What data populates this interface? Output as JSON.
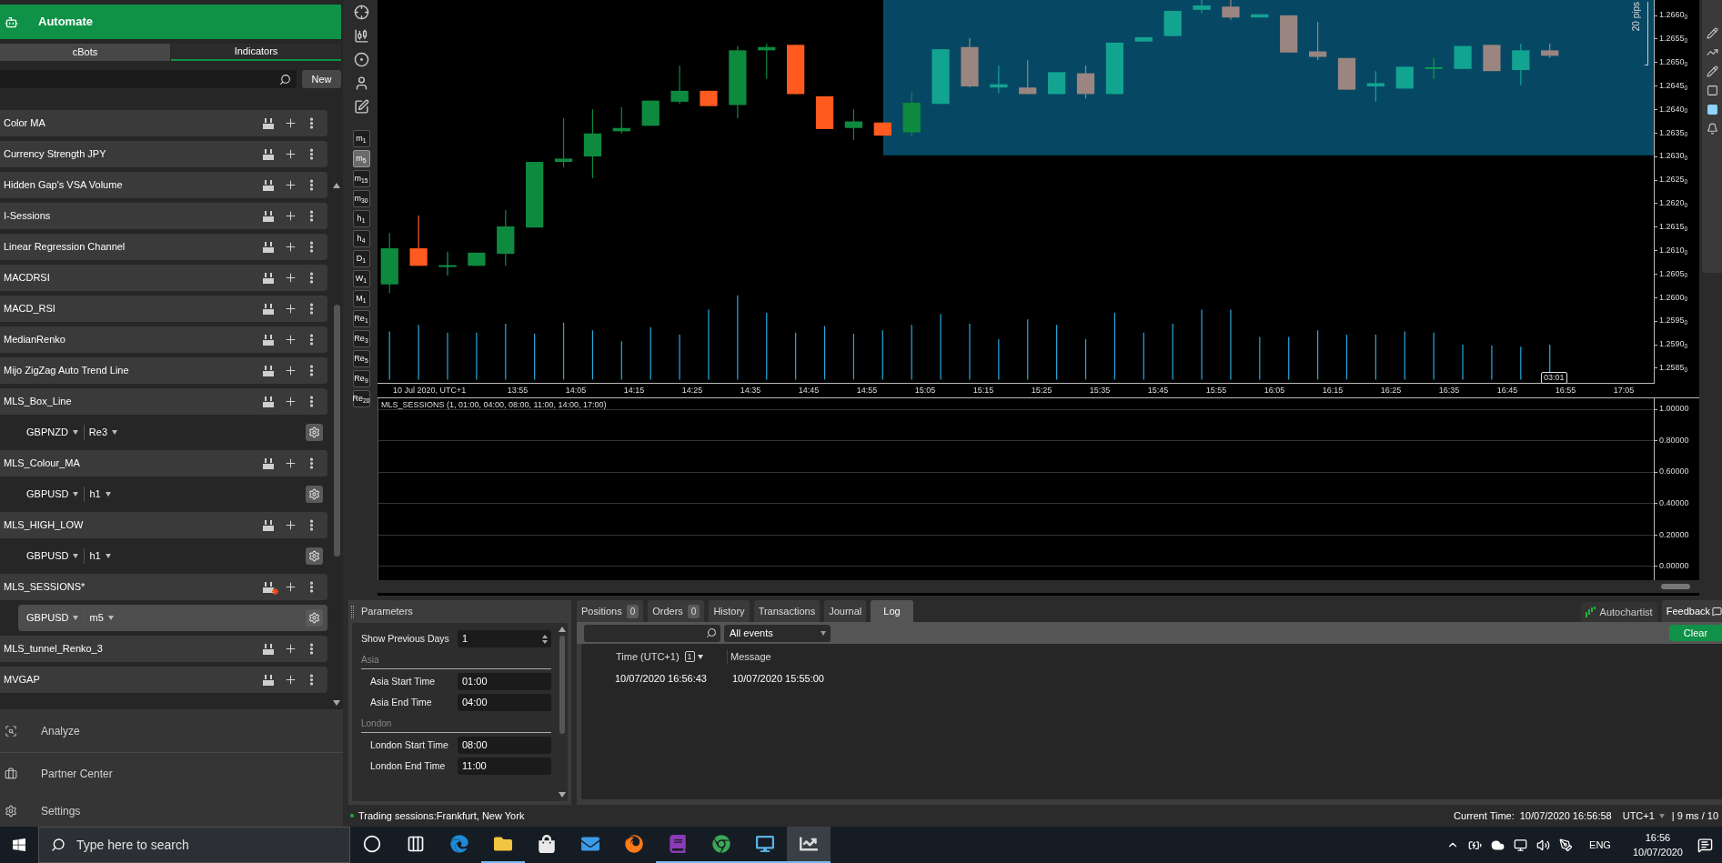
{
  "sidebar": {
    "title": "Automate",
    "tabs": [
      {
        "label": "cBots",
        "selected": false
      },
      {
        "label": "Indicators",
        "selected": true
      }
    ],
    "new_button": "New",
    "items": [
      {
        "kind": "indicator",
        "name": "Color MA",
        "modified": false
      },
      {
        "kind": "indicator",
        "name": "Currency Strength JPY",
        "modified": false
      },
      {
        "kind": "indicator",
        "name": "Hidden Gap's VSA Volume",
        "modified": false
      },
      {
        "kind": "indicator",
        "name": "I-Sessions",
        "modified": false
      },
      {
        "kind": "indicator",
        "name": "Linear Regression Channel",
        "modified": false
      },
      {
        "kind": "indicator",
        "name": "MACDRSI",
        "modified": false
      },
      {
        "kind": "indicator",
        "name": "MACD_RSI",
        "modified": false
      },
      {
        "kind": "indicator",
        "name": "MedianRenko",
        "modified": false
      },
      {
        "kind": "indicator",
        "name": "Mijo ZigZag Auto Trend Line",
        "modified": false
      },
      {
        "kind": "indicator",
        "name": "MLS_Box_Line",
        "modified": false
      },
      {
        "kind": "instance",
        "symbol": "GBPNZD",
        "timeframe": "Re3",
        "selected": false
      },
      {
        "kind": "indicator",
        "name": "MLS_Colour_MA",
        "modified": false
      },
      {
        "kind": "instance",
        "symbol": "GBPUSD",
        "timeframe": "h1",
        "selected": false
      },
      {
        "kind": "indicator",
        "name": "MLS_HIGH_LOW",
        "modified": false
      },
      {
        "kind": "instance",
        "symbol": "GBPUSD",
        "timeframe": "h1",
        "selected": false
      },
      {
        "kind": "indicator",
        "name": "MLS_SESSIONS*",
        "modified": true
      },
      {
        "kind": "instance",
        "symbol": "GBPUSD",
        "timeframe": "m5",
        "selected": true
      },
      {
        "kind": "indicator",
        "name": "MLS_tunnel_Renko_3",
        "modified": false
      },
      {
        "kind": "indicator",
        "name": "MVGAP",
        "modified": false
      }
    ],
    "nav": [
      {
        "kind": "analyze",
        "label": "Analyze"
      },
      {
        "kind": "partner",
        "label": "Partner Center"
      },
      {
        "kind": "settings",
        "label": "Settings"
      }
    ]
  },
  "chart": {
    "timeframes": [
      {
        "label": "m$_{1}$",
        "selected": false
      },
      {
        "label": "m$_{5}$",
        "selected": true
      },
      {
        "label": "m$_{15}$",
        "selected": false
      },
      {
        "label": "m$_{30}$",
        "selected": false
      },
      {
        "label": "h$_{1}$",
        "selected": false
      },
      {
        "label": "h$_{4}$",
        "selected": false
      },
      {
        "label": "D$_{1}$",
        "selected": false
      },
      {
        "label": "W$_{1}$",
        "selected": false
      },
      {
        "label": "M$_{1}$",
        "selected": false
      },
      {
        "label": "Re$_{1}$",
        "selected": false
      },
      {
        "label": "Re$_{3}$",
        "selected": false
      },
      {
        "label": "Re$_{5}$",
        "selected": false
      },
      {
        "label": "Re$_{9}$",
        "selected": false
      },
      {
        "label": "Re$_{20}$",
        "selected": false
      }
    ],
    "price_ticks": [
      "1.2660$_{0}$",
      "1.2655$_{0}$",
      "1.2650$_{0}$",
      "1.2645$_{0}$",
      "1.2640$_{0}$",
      "1.2635$_{0}$",
      "1.2630$_{0}$",
      "1.2625$_{0}$",
      "1.2620$_{0}$",
      "1.2615$_{0}$",
      "1.2610$_{0}$",
      "1.2605$_{0}$",
      "1.2600$_{0}$",
      "1.2595$_{0}$",
      "1.2590$_{0}$",
      "1.2585$_{0}$"
    ],
    "date_label": "10 Jul 2020, UTC+1",
    "time_labels": [
      "13:55",
      "14:05",
      "14:15",
      "14:25",
      "14:35",
      "14:45",
      "14:55",
      "15:05",
      "15:15",
      "15:25",
      "15:35",
      "15:45",
      "15:55",
      "16:05",
      "16:15",
      "16:25",
      "16:35",
      "16:45",
      "16:55",
      "17:05"
    ],
    "countdown": "03:01",
    "range_label": "20 pips",
    "indicator": {
      "title": "MLS_SESSIONS (1, 01:00, 04:00, 08:00, 11:00, 14:00, 17:00)",
      "ticks": [
        "1.00000",
        "0.80000",
        "0.60000",
        "0.40000",
        "0.20000",
        "0.00000"
      ]
    }
  },
  "parameters": {
    "title": "Parameters",
    "rows": [
      {
        "kind": "spinner",
        "label": "Show Previous Days",
        "value": "1"
      },
      {
        "kind": "section",
        "label": "Asia"
      },
      {
        "kind": "field",
        "label": "Asia Start Time",
        "value": "01:00"
      },
      {
        "kind": "field",
        "label": "Asia End Time",
        "value": "04:00"
      },
      {
        "kind": "section",
        "label": "London"
      },
      {
        "kind": "field",
        "label": "London Start Time",
        "value": "08:00"
      },
      {
        "kind": "field",
        "label": "London End Time",
        "value": "11:00"
      }
    ]
  },
  "log": {
    "tabs": [
      {
        "label": "Positions",
        "count": "0",
        "selected": false
      },
      {
        "label": "Orders",
        "count": "0",
        "selected": false
      },
      {
        "label": "History",
        "selected": false
      },
      {
        "label": "Transactions",
        "selected": false
      },
      {
        "label": "Journal",
        "selected": false
      },
      {
        "label": "Log",
        "selected": true
      }
    ],
    "autochartist": "Autochartist",
    "feedback": "Feedback",
    "filter": "All events",
    "clear": "Clear",
    "columns": [
      {
        "label": "Time (UTC+1)",
        "sort_badge": "1"
      },
      {
        "label": "Message"
      }
    ],
    "rows": [
      [
        "10/07/2020 16:56:43",
        "10/07/2020 15:55:00"
      ]
    ]
  },
  "status_bar": {
    "sessions": "Trading sessions:Frankfurt, New York",
    "current_time_label": "Current Time:",
    "current_time": "10/07/2020 16:56:58",
    "timezone": "UTC+1",
    "latency": "| 9 ms / 10"
  },
  "taskbar": {
    "search_placeholder": "Type here to search",
    "apps": [
      {
        "kind": "cortana",
        "running": false,
        "selected": false
      },
      {
        "kind": "taskview",
        "running": false,
        "selected": false
      },
      {
        "kind": "edge",
        "running": false,
        "selected": false
      },
      {
        "kind": "explorer",
        "running": true,
        "selected": false
      },
      {
        "kind": "store",
        "running": false,
        "selected": false
      },
      {
        "kind": "mail",
        "running": false,
        "selected": false
      },
      {
        "kind": "firefox",
        "running": false,
        "selected": false
      },
      {
        "kind": "onenote",
        "running": true,
        "selected": false
      },
      {
        "kind": "chrome",
        "running": true,
        "selected": false
      },
      {
        "kind": "remote",
        "running": true,
        "selected": false
      },
      {
        "kind": "trader",
        "running": true,
        "selected": true
      }
    ],
    "language": "ENG",
    "time": "16:56",
    "date": "10/07/2020"
  }
}
